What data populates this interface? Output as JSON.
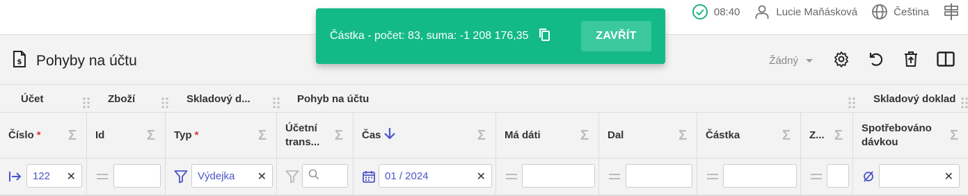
{
  "topbar": {
    "time": "08:40",
    "user": "Lucie Maňásková",
    "language": "Čeština"
  },
  "toast": {
    "message": "Částka - počet: 83, suma: -1 208 176,35",
    "close_label": "ZAVŘÍT"
  },
  "page": {
    "title": "Pohyby na účtu",
    "view_selected": "Žádný"
  },
  "groups": {
    "ucet": "Účet",
    "zbozi": "Zboží",
    "skladovy_short": "Skladový d...",
    "pohyb": "Pohyb na účtu",
    "skladovy": "Skladový doklad"
  },
  "columns": {
    "cislo": "Číslo",
    "id": "Id",
    "typ": "Typ",
    "ucetni_trans": "Účetní trans...",
    "cas": "Čas",
    "ma_dati": "Má dáti",
    "dal": "Dal",
    "castka": "Částka",
    "z": "Z...",
    "spotrebovano": "Spotřebováno dávkou",
    "required_mark": "*",
    "sum_symbol": "Σ"
  },
  "filters": {
    "cislo": "122",
    "typ": "Výdejka",
    "cas": "01 / 2024",
    "clear_symbol": "✕"
  },
  "icons": {
    "status": "check-circle-icon",
    "user": "user-icon",
    "language": "globe-icon",
    "menu": "signpost-icon",
    "copy": "copy-icon"
  },
  "colors": {
    "toast_bg": "#13b987",
    "accent": "#4a55c8",
    "required": "#d33333"
  }
}
